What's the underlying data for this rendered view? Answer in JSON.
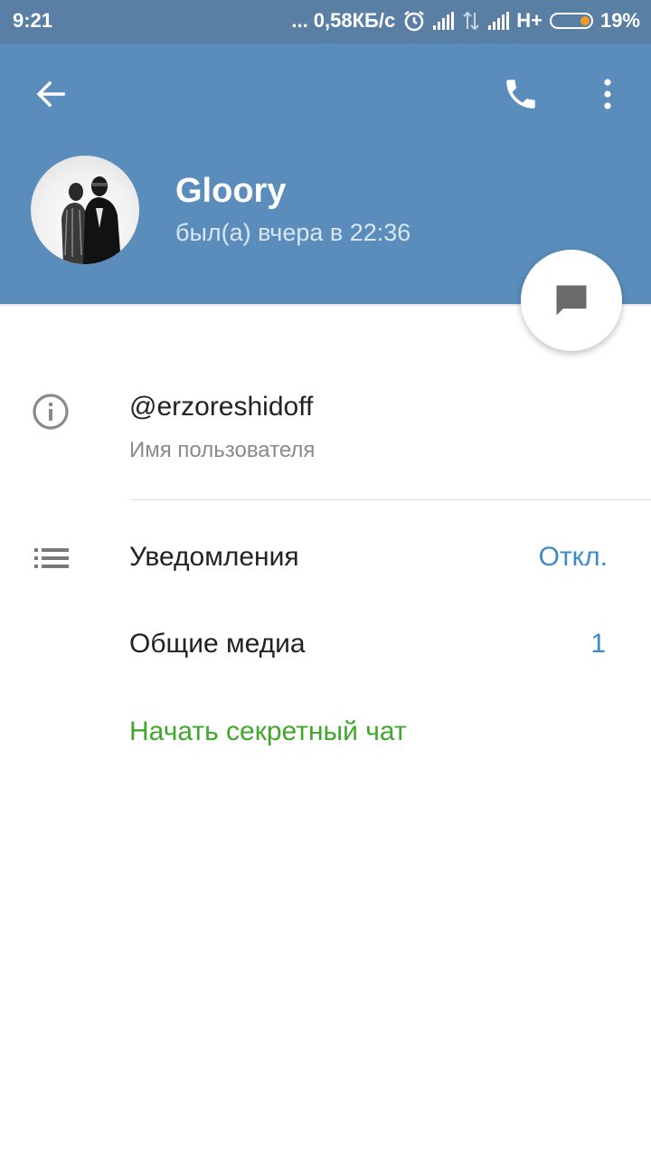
{
  "status_bar": {
    "time": "9:21",
    "network_speed": "... 0,58КБ/с",
    "network_type": "H+",
    "battery": "19%"
  },
  "header": {
    "name": "Gloory",
    "last_seen": "был(а) вчера в 22:36",
    "background_color": "#5a8dbb"
  },
  "info": {
    "username": "@erzoreshidoff",
    "username_label": "Имя пользователя"
  },
  "settings": {
    "notifications_label": "Уведомления",
    "notifications_value": "Откл.",
    "shared_media_label": "Общие медиа",
    "shared_media_value": "1",
    "secret_chat_label": "Начать секретный чат"
  },
  "colors": {
    "link_blue": "#3a8bc8",
    "secret_green": "#3fa82a"
  }
}
